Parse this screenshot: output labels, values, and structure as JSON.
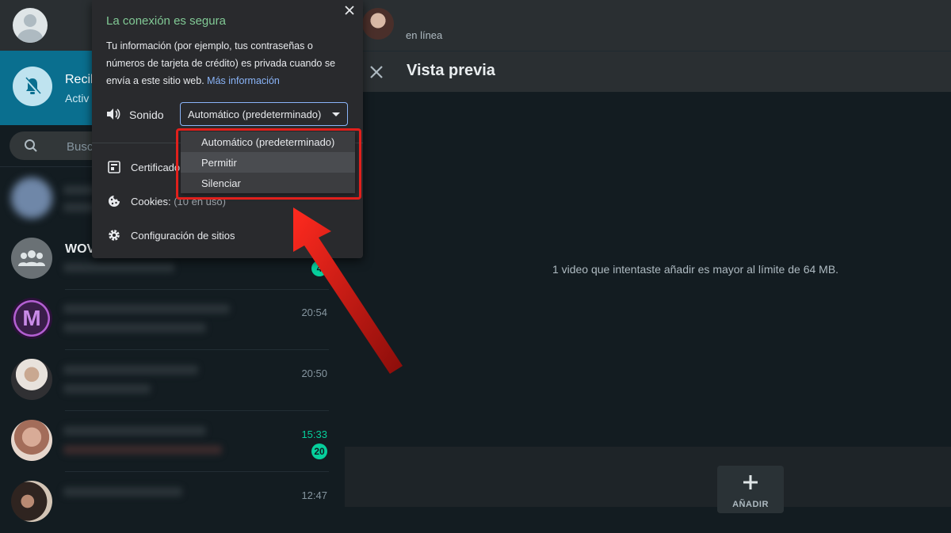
{
  "sidebar": {
    "notification": {
      "title": "Recil",
      "subtitle": "Activ"
    },
    "search": {
      "placeholder": "Busca"
    },
    "chats": [
      {
        "name": "",
        "time": "",
        "badge": ""
      },
      {
        "name": "WOV",
        "time": "",
        "badge": "4"
      },
      {
        "name": "",
        "time": "20:54",
        "badge": ""
      },
      {
        "name": "",
        "time": "20:50",
        "badge": ""
      },
      {
        "name": "",
        "time": "15:33",
        "badge": "20"
      },
      {
        "name": "",
        "time": "12:47",
        "badge": ""
      }
    ]
  },
  "conversation": {
    "status": "en línea",
    "preview": {
      "title": "Vista previa",
      "message": "1 video que intentaste añadir es mayor al límite de 64 MB.",
      "add_label": "AÑADIR"
    }
  },
  "site_popup": {
    "title": "La conexión es segura",
    "description": "Tu información (por ejemplo, tus contraseñas o números de tarjeta de crédito) es privada cuando se envía a este sitio web. ",
    "link": "Más información",
    "sound_label": "Sonido",
    "sound_value": "Automático (predeterminado)",
    "certificate_label": "Certificado",
    "cookies_label": "Cookies:",
    "cookies_sub": "(10 en uso)",
    "site_settings_label": "Configuración de sitios"
  },
  "sound_options": [
    "Automático (predeterminado)",
    "Permitir",
    "Silenciar"
  ],
  "colors": {
    "accent_green": "#06cf9c",
    "link_blue": "#8ab4f8",
    "highlight_red": "#e0201c",
    "banner_blue": "#0a6f8f"
  }
}
